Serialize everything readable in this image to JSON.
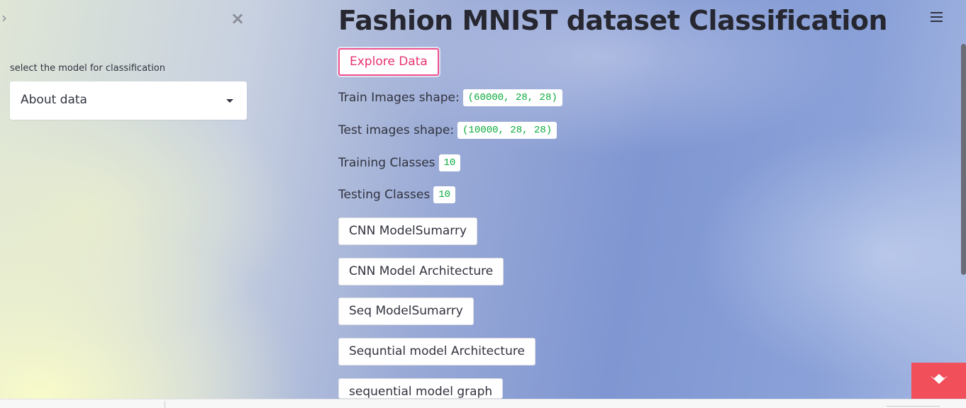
{
  "sidebar": {
    "expand_icon": "›",
    "close_icon": "×",
    "select_label": "select the model for classification",
    "selected_value": "About data"
  },
  "main": {
    "title": "Fashion MNIST dataset Classification",
    "explore_button": "Explore Data",
    "stats": [
      {
        "label": "Train Images shape:",
        "value": "(60000, 28, 28)"
      },
      {
        "label": "Test images shape:",
        "value": "(10000, 28, 28)"
      },
      {
        "label": "Training Classes",
        "value": "10"
      },
      {
        "label": "Testing Classes",
        "value": "10"
      }
    ],
    "buttons": [
      "CNN ModelSumarry",
      "CNN Model Architecture",
      "Seq ModelSumarry",
      "Sequntial model Architecture",
      "sequential model graph"
    ]
  },
  "colors": {
    "accent": "#f0518d",
    "code_text": "#09ab3b",
    "logo_bg": "#f1505a"
  },
  "icons": {
    "menu": "hamburger-menu-icon",
    "logo": "streamlit-logo-icon"
  }
}
